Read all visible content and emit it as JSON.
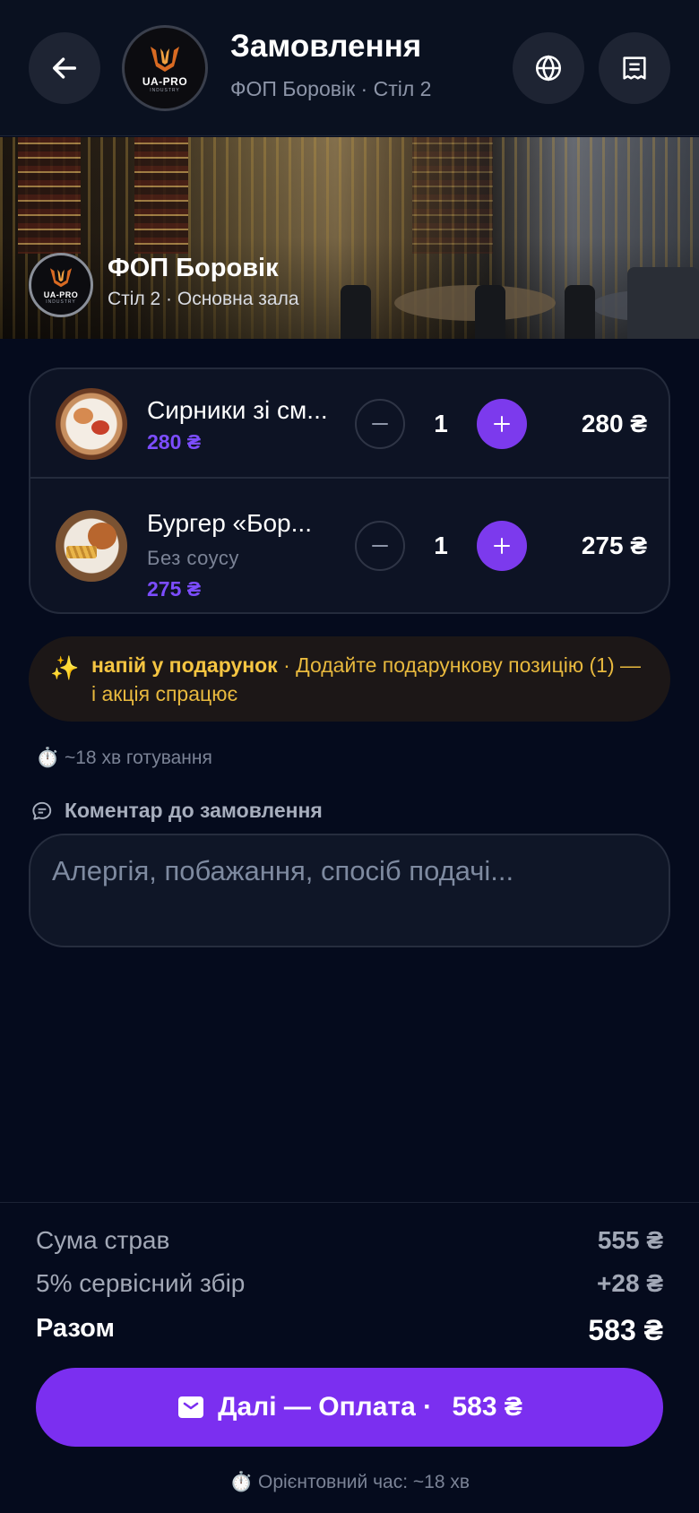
{
  "header": {
    "title": "Замовлення",
    "subtitle": "ФОП Боровік · Стіл 2",
    "logo_text": "UA-PRO",
    "logo_sub": "INDUSTRY"
  },
  "venue": {
    "name": "ФОП Боровік",
    "details": "Стіл 2 · Основна зала",
    "logo_text": "UA-PRO",
    "logo_sub": "INDUSTRY"
  },
  "cart": {
    "items": [
      {
        "name": "Сирники зі см...",
        "modifier": "",
        "price": "280 ₴",
        "quantity": "1",
        "line_total": "280 ₴"
      },
      {
        "name": "Бургер «Бор...",
        "modifier": "Без соусу",
        "price": "275 ₴",
        "quantity": "1",
        "line_total": "275 ₴"
      }
    ]
  },
  "promo": {
    "icon": "sparkles-icon",
    "title": "напій у подарунок",
    "text": " · Додайте подарункову позицію (1) — і акція спрацює"
  },
  "cook_time": "⏱️ ~18 хв готування",
  "comment": {
    "label": "Коментар до замовлення",
    "placeholder": "Алергія, побажання, спосіб подачі...",
    "value": ""
  },
  "summary": {
    "subtotal_label": "Сума страв",
    "subtotal_value": "555 ₴",
    "service_label": "5% сервісний збір",
    "service_value": "+28 ₴",
    "total_label": "Разом",
    "total_value": "583 ₴"
  },
  "pay_button": {
    "label": "Далі — Оплата · ",
    "amount": "583 ₴"
  },
  "eta": "⏱️ Орієнтовний час: ~18 хв",
  "colors": {
    "accent": "#7c3aed",
    "price": "#7c4dff",
    "promo": "#f5c542",
    "background": "#050b1d"
  }
}
